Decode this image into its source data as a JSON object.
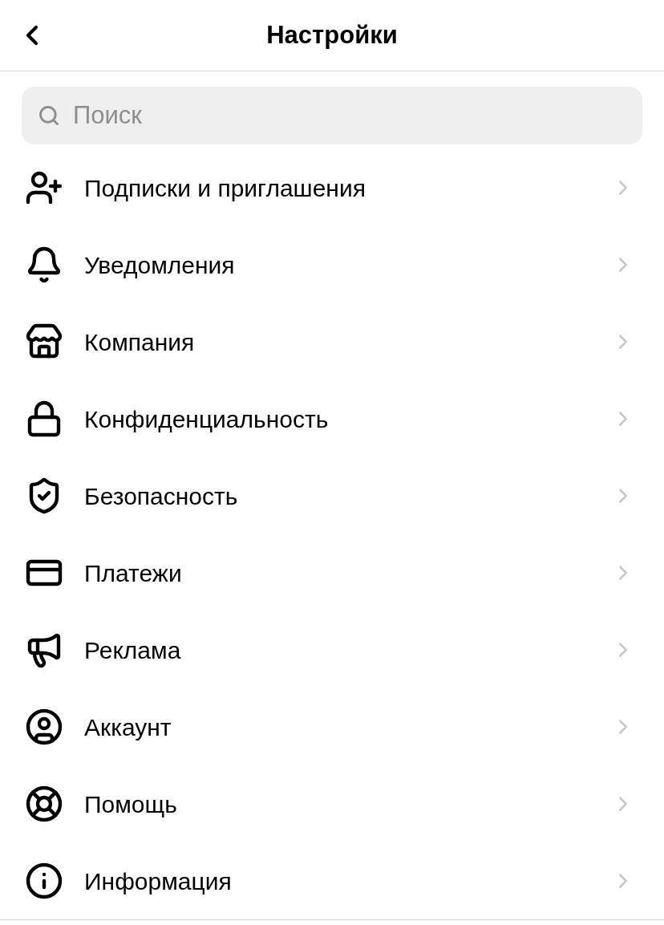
{
  "header": {
    "title": "Настройки"
  },
  "search": {
    "placeholder": "Поиск"
  },
  "items": [
    {
      "kind": "follow",
      "label": "Подписки и приглашения"
    },
    {
      "kind": "notifications",
      "label": "Уведомления"
    },
    {
      "kind": "business",
      "label": "Компания"
    },
    {
      "kind": "privacy",
      "label": "Конфиденциальность"
    },
    {
      "kind": "security",
      "label": "Безопасность"
    },
    {
      "kind": "payments",
      "label": "Платежи"
    },
    {
      "kind": "ads",
      "label": "Реклама"
    },
    {
      "kind": "account",
      "label": "Аккаунт"
    },
    {
      "kind": "help",
      "label": "Помощь"
    },
    {
      "kind": "about",
      "label": "Информация"
    }
  ]
}
